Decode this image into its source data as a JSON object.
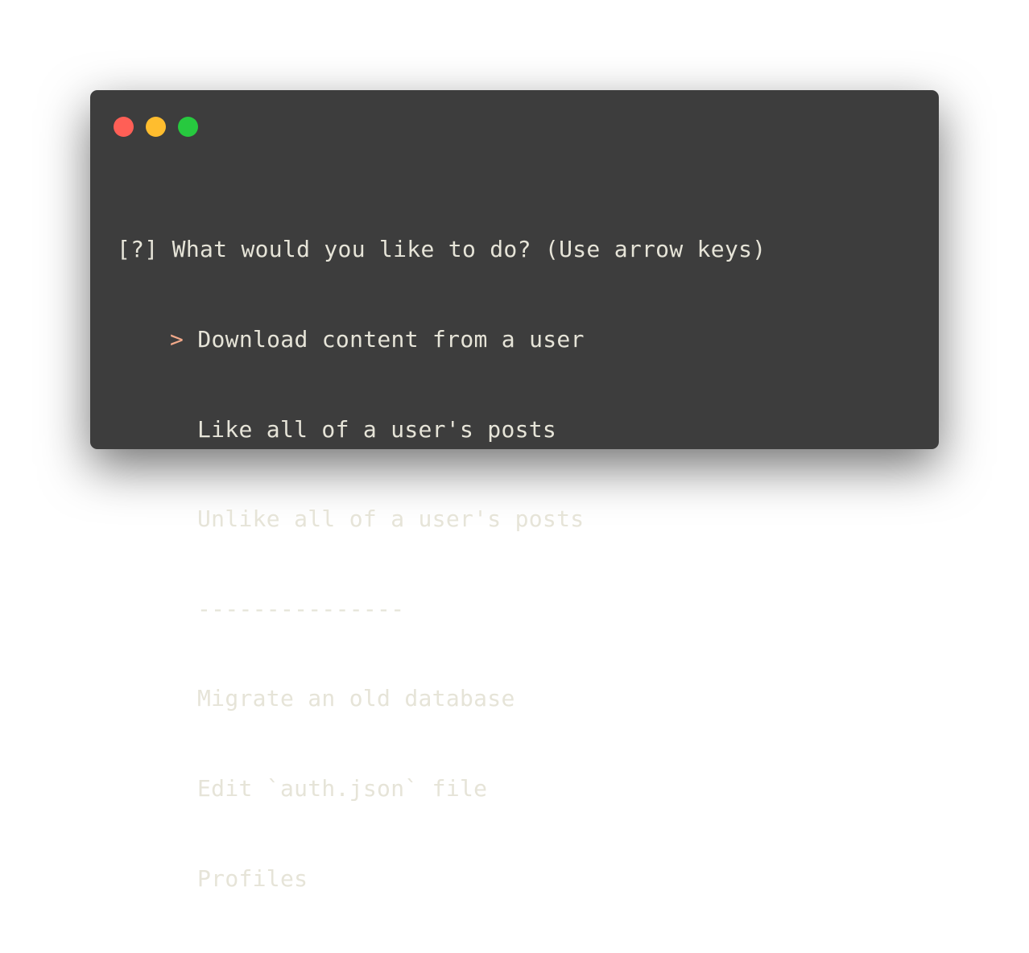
{
  "window": {
    "buttons": [
      "close",
      "minimize",
      "zoom"
    ]
  },
  "prompt": {
    "marker": "[?]",
    "question": "What would you like to do? (Use arrow keys)",
    "pointer": ">"
  },
  "menu": {
    "selected_index": 0,
    "items": [
      "Download content from a user",
      "Like all of a user's posts",
      "Unlike all of a user's posts"
    ],
    "separator": "---------------",
    "items_after": [
      "Migrate an old database",
      "Edit `auth.json` file",
      "Profiles"
    ]
  },
  "colors": {
    "background": "#3d3d3d",
    "text": "#e6e4d8",
    "pointer": "#f2a98a",
    "close": "#ff5f56",
    "minimize": "#ffbd2e",
    "zoom": "#27c93f"
  }
}
